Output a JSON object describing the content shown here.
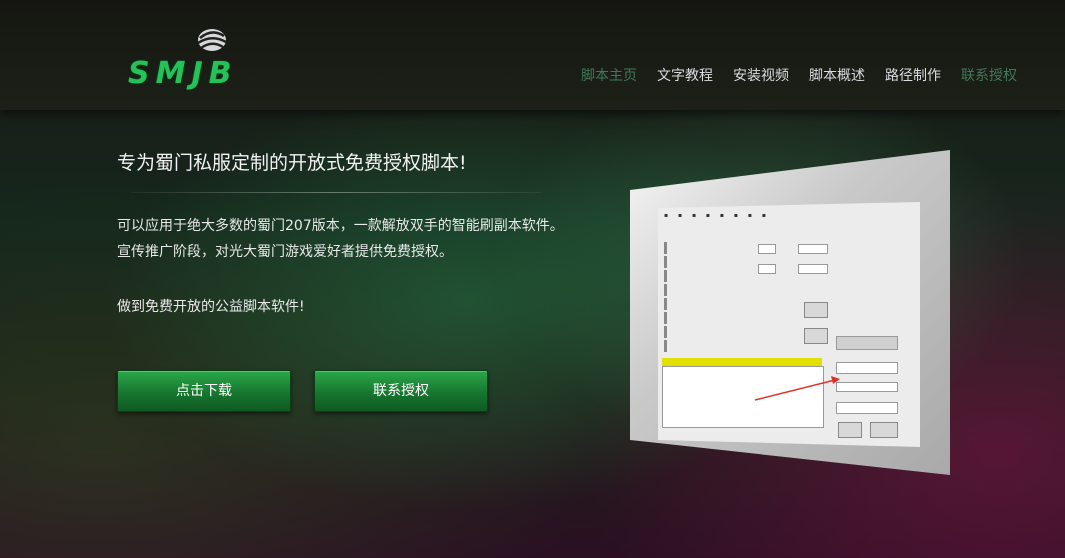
{
  "header": {
    "logo_text": "SMJB",
    "nav": [
      {
        "label": "脚本主页",
        "style": "dim"
      },
      {
        "label": "文字教程",
        "style": "normal"
      },
      {
        "label": "安装视频",
        "style": "normal"
      },
      {
        "label": "脚本概述",
        "style": "normal"
      },
      {
        "label": "路径制作",
        "style": "normal"
      },
      {
        "label": "联系授权",
        "style": "dim"
      }
    ]
  },
  "hero": {
    "title": "专为蜀门私服定制的开放式免费授权脚本!",
    "description": "可以应用于绝大多数的蜀门207版本，一款解放双手的智能刷副本软件。宣传推广阶段，对光大蜀门游戏爱好者提供免费授权。",
    "slogan": "做到免费开放的公益脚本软件!",
    "download_button": "点击下载",
    "contact_button": "联系授权"
  },
  "colors": {
    "brand_green": "#24c35a",
    "button_green": "#17762f",
    "nav_dim": "#3f7a58",
    "arrow_red": "#e0302a"
  },
  "icons": [
    "logo-mark-icon",
    "red-arrow-icon"
  ]
}
